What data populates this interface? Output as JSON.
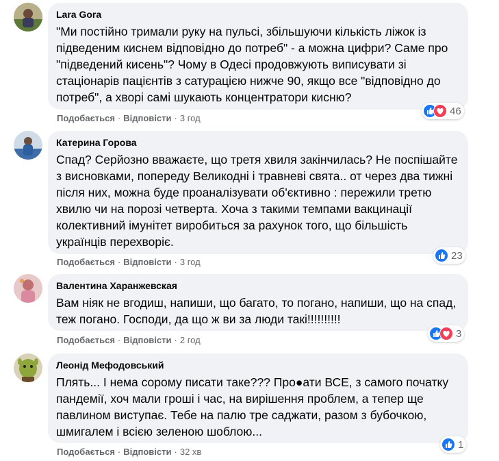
{
  "comments": [
    {
      "author": "Lara Gora",
      "text": "\"Ми постійно тримали руку на пульсі, збільшуючи кількість ліжок із підведеним киснем відповідно до потреб\" - а можна цифри? Саме про \"підведений кисень\"? Чому в Одесі продовжують виписувати зі стаціонарів пацієнтів з сатурацією нижче 90, якщо все \"відповідно до потреб\", а хворі самі шукають концентратори кисню?",
      "like_label": "Подобається",
      "reply_label": "Відповісти",
      "time": "3 год",
      "reaction_count": "46",
      "reactions": [
        "like-icon",
        "love-icon"
      ]
    },
    {
      "author": "Катерина Горова",
      "text": "Спад? Серйозно вважаєте, що третя хвиля закінчилась? Не поспішайте з висновками, попереду Великодні і травневі свята.. от через два тижні після них, можна буде проаналізувати об'єктивно : пережили третю хвилю чи на порозі четверта. Хоча з такими темпами вакцинації колективний імунітет виробиться за рахунок того, що більшість українців перехворіє.",
      "like_label": "Подобається",
      "reply_label": "Відповісти",
      "time": "3 год",
      "reaction_count": "23",
      "reactions": [
        "like-icon"
      ]
    },
    {
      "author": "Валентина Харанжевская",
      "text": "Вам ніяк не вгодиш, напиши, що багато, то погано, напиши, що на спад, теж погано. Господи, да що ж ви за люди такі!!!!!!!!!!",
      "like_label": "Подобається",
      "reply_label": "Відповісти",
      "time": "2 год",
      "reaction_count": "3",
      "reactions": [
        "like-icon",
        "love-icon"
      ]
    },
    {
      "author": "Леонід Мефодовський",
      "text": "Плять... І нема сорому писати таке??? Про●ати ВСЕ, з самого початку пандемії, хоч мали гроші і час, на вирішення проблем, а тепер ще павлином виступає. Тебе на палю тре саджати, разом з бубочкою, шмигалем і всією зеленою шоблою...",
      "like_label": "Подобається",
      "reply_label": "Відповісти",
      "time": "32 хв",
      "reaction_count": "1",
      "reactions": [
        "like-icon"
      ]
    }
  ],
  "separator": "·",
  "colors": {
    "bubble": "#f0f2f5",
    "like_blue": "#1877f2",
    "love_red": "#f33e58",
    "meta_gray": "#65676b"
  }
}
